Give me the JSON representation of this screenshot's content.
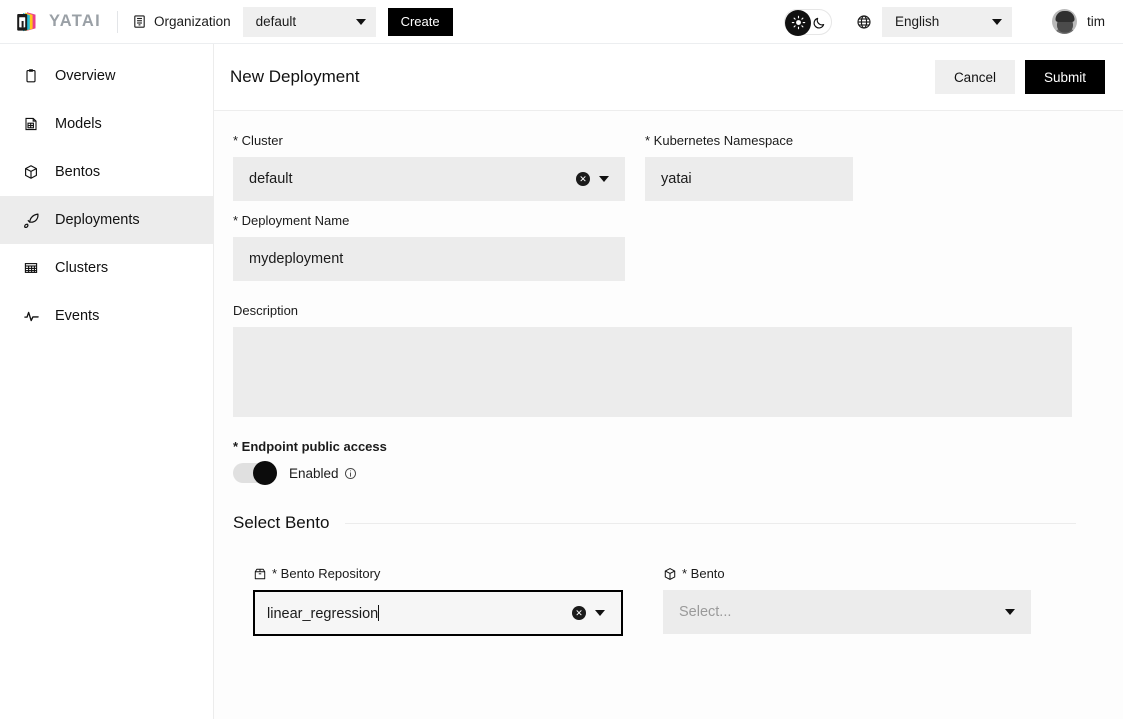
{
  "brand": {
    "name": "YATAI",
    "logo_icon": "yatai-logo-icon"
  },
  "topbar": {
    "org_icon": "organization-icon",
    "org_label": "Organization",
    "org_value": "default",
    "create_label": "Create",
    "theme": {
      "sun_icon": "sun-icon",
      "moon_icon": "moon-icon",
      "active": "light"
    },
    "globe_icon": "globe-icon",
    "language_value": "English",
    "user_name": "tim",
    "avatar_icon": "avatar"
  },
  "sidebar": {
    "items": [
      {
        "label": "Overview",
        "icon": "clipboard-icon",
        "active": false
      },
      {
        "label": "Models",
        "icon": "model-icon",
        "active": false
      },
      {
        "label": "Bentos",
        "icon": "cube-icon",
        "active": false
      },
      {
        "label": "Deployments",
        "icon": "rocket-icon",
        "active": true
      },
      {
        "label": "Clusters",
        "icon": "grid-server-icon",
        "active": false
      },
      {
        "label": "Events",
        "icon": "activity-icon",
        "active": false
      }
    ]
  },
  "page": {
    "title": "New Deployment",
    "cancel_label": "Cancel",
    "submit_label": "Submit"
  },
  "form": {
    "cluster": {
      "label": "* Cluster",
      "value": "default",
      "clear_icon": "clear-circle-icon",
      "caret_icon": "chevron-down-icon"
    },
    "namespace": {
      "label": "* Kubernetes Namespace",
      "value": "yatai"
    },
    "deployment_name": {
      "label": "* Deployment Name",
      "value": "mydeployment"
    },
    "description": {
      "label": "Description",
      "value": "",
      "placeholder": ""
    },
    "endpoint_access": {
      "label": "* Endpoint public access",
      "toggle_state": "on",
      "state_label": "Enabled",
      "info_icon": "info-icon"
    }
  },
  "select_bento": {
    "section_title": "Select Bento",
    "repository": {
      "label": "* Bento Repository",
      "icon": "package-icon",
      "value": "linear_regression",
      "focused": true,
      "clear_icon": "clear-circle-icon",
      "caret_icon": "chevron-down-icon"
    },
    "bento": {
      "label": "* Bento",
      "icon": "cube-icon",
      "value": "",
      "placeholder": "Select...",
      "caret_icon": "chevron-down-icon"
    }
  },
  "colors": {
    "accent_black": "#000000",
    "field_bg": "#ececec",
    "sidebar_active": "#ececec",
    "brand_gray": "#9aa0a6",
    "logo_pink": "#ea3e8c",
    "logo_yellow": "#ffc61a",
    "logo_cyan": "#23bcd8",
    "placeholder_gray": "#9a9a9a"
  }
}
